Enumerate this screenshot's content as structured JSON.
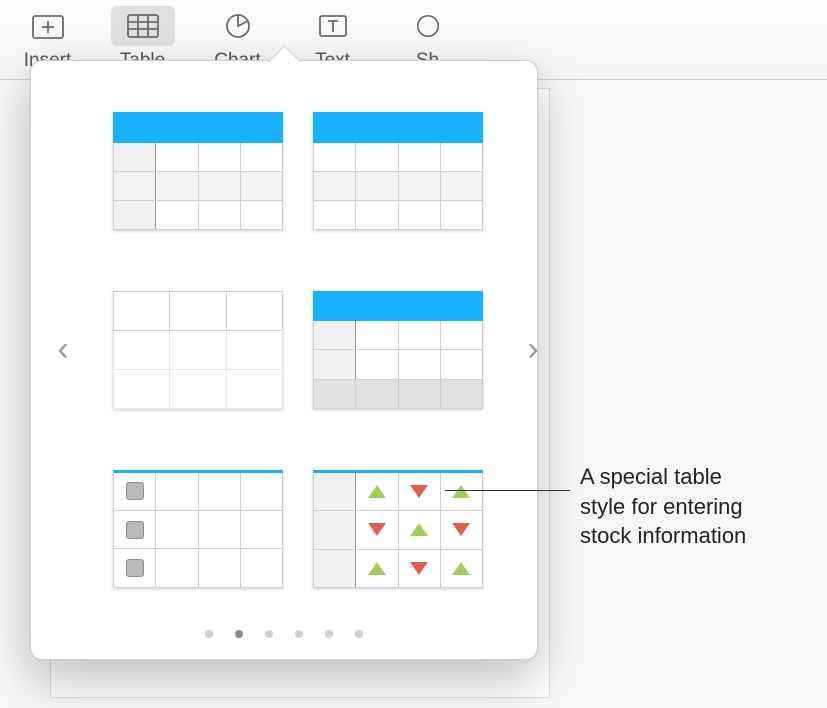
{
  "toolbar": {
    "items": [
      {
        "label": "Insert",
        "icon": "insert-icon"
      },
      {
        "label": "Table",
        "icon": "table-icon",
        "active": true
      },
      {
        "label": "Chart",
        "icon": "chart-icon"
      },
      {
        "label": "Text",
        "icon": "text-icon"
      },
      {
        "label": "Shape",
        "icon": "shape-icon",
        "truncated_label": "Sh"
      }
    ]
  },
  "popover": {
    "nav_prev_glyph": "‹",
    "nav_next_glyph": "›",
    "page_count": 6,
    "active_page_index": 1,
    "styles": [
      {
        "name": "table-style-header-sidecol",
        "has_header": true,
        "has_side": true,
        "alt_rows": true
      },
      {
        "name": "table-style-header-plain",
        "has_header": true,
        "has_side": false,
        "alt_rows": true
      },
      {
        "name": "table-style-plain-grid",
        "has_header": false,
        "has_side": false,
        "alt_rows": false
      },
      {
        "name": "table-style-header-footer",
        "has_header": true,
        "has_side": true,
        "alt_rows": false,
        "has_footer": true
      },
      {
        "name": "table-style-checklist",
        "has_header": true,
        "has_side": false,
        "checkbox_col": true
      },
      {
        "name": "table-style-stock",
        "has_header": true,
        "has_side": true,
        "stock_arrows": true
      }
    ]
  },
  "callout": {
    "line1": "A special table",
    "line2": "style for entering",
    "line3": "stock information"
  },
  "colors": {
    "accent_header": "#19b2ff",
    "up_arrow": "#9fce5b",
    "down_arrow": "#e0604e"
  }
}
